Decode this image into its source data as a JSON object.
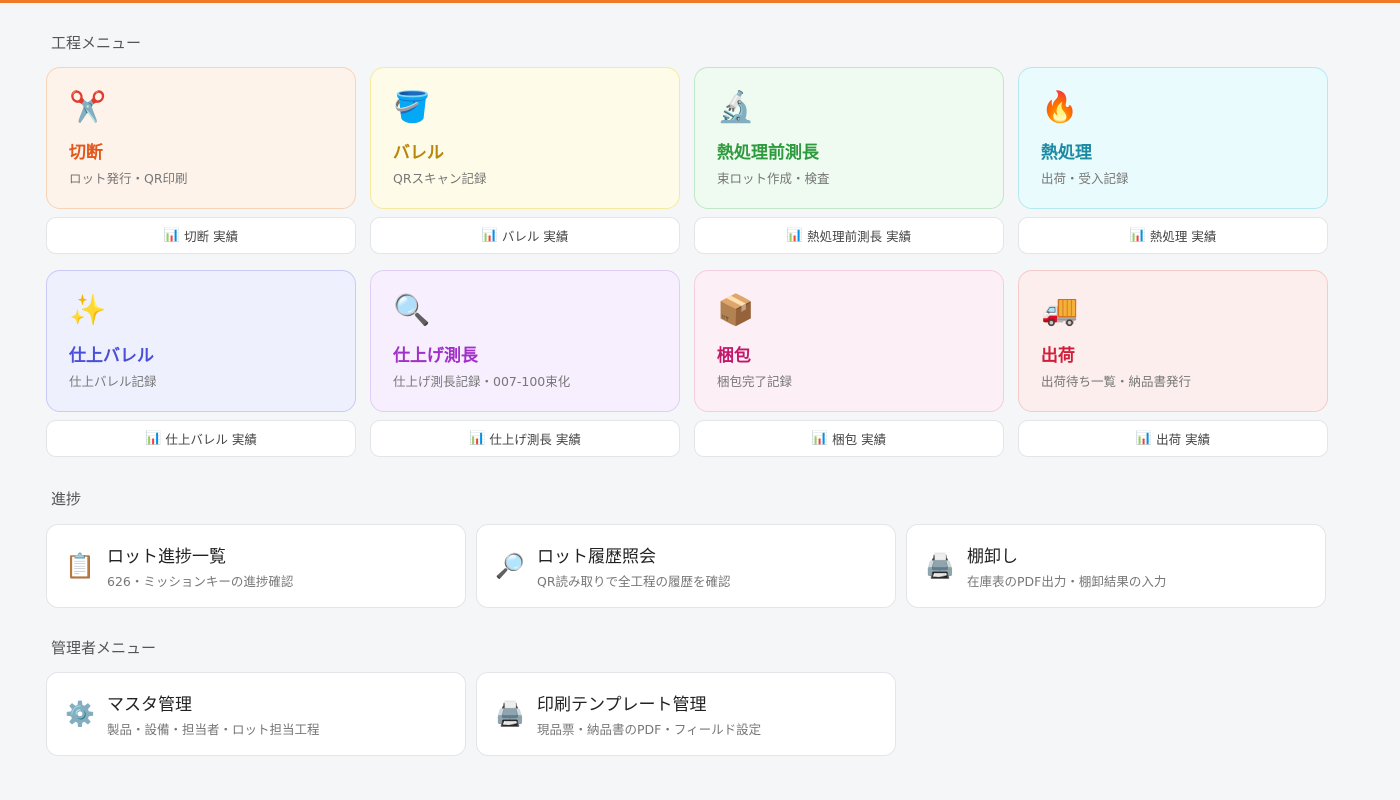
{
  "sections": {
    "process_menu": "工程メニュー",
    "progress": "進捗",
    "admin_menu": "管理者メニュー"
  },
  "colors": {
    "accent": "#f07a28",
    "cutting": "#e2571b",
    "barrel": "#b8860b",
    "pre_heat_measure": "#2e9a3e",
    "heat_treatment": "#1b8aa3",
    "finish_barrel": "#4b4fd8",
    "finish_measure": "#a22fc9",
    "packing": "#c2186b",
    "shipping": "#d01d3a"
  },
  "processes": [
    {
      "icon": "scissors-icon",
      "glyph": "✂️",
      "title": "切断",
      "subtitle": "ロット発行・QR印刷",
      "result": "切断 実績"
    },
    {
      "icon": "bucket-icon",
      "glyph": "🪣",
      "title": "バレル",
      "subtitle": "QRスキャン記録",
      "result": "バレル 実績"
    },
    {
      "icon": "microscope-icon",
      "glyph": "🔬",
      "title": "熱処理前測長",
      "subtitle": "束ロット作成・検査",
      "result": "熱処理前測長 実績"
    },
    {
      "icon": "fire-icon",
      "glyph": "🔥",
      "title": "熱処理",
      "subtitle": "出荷・受入記録",
      "result": "熱処理 実績"
    },
    {
      "icon": "sparkles-icon",
      "glyph": "✨",
      "title": "仕上バレル",
      "subtitle": "仕上バレル記録",
      "result": "仕上バレル 実績"
    },
    {
      "icon": "magnifier-icon",
      "glyph": "🔍",
      "title": "仕上げ測長",
      "subtitle": "仕上げ測長記録・007-100束化",
      "result": "仕上げ測長 実績"
    },
    {
      "icon": "package-icon",
      "glyph": "📦",
      "title": "梱包",
      "subtitle": "梱包完了記録",
      "result": "梱包 実績"
    },
    {
      "icon": "truck-icon",
      "glyph": "🚚",
      "title": "出荷",
      "subtitle": "出荷待ち一覧・納品書発行",
      "result": "出荷 実績"
    }
  ],
  "result_icon": "bar-chart-icon",
  "result_glyph": "📊",
  "progress": [
    {
      "icon": "clipboard-icon",
      "glyph": "📋",
      "title": "ロット進捗一覧",
      "subtitle": "626・ミッションキーの進捗確認"
    },
    {
      "icon": "magnifier-icon",
      "glyph": "🔎",
      "title": "ロット履歴照会",
      "subtitle": "QR読み取りで全工程の履歴を確認"
    },
    {
      "icon": "printer-icon",
      "glyph": "🖨️",
      "title": "棚卸し",
      "subtitle": "在庫表のPDF出力・棚卸結果の入力"
    }
  ],
  "admin": [
    {
      "icon": "gear-icon",
      "glyph": "⚙️",
      "title": "マスタ管理",
      "subtitle": "製品・設備・担当者・ロット担当工程"
    },
    {
      "icon": "printer-icon",
      "glyph": "🖨️",
      "title": "印刷テンプレート管理",
      "subtitle": "現品票・納品書のPDF・フィールド設定"
    }
  ]
}
